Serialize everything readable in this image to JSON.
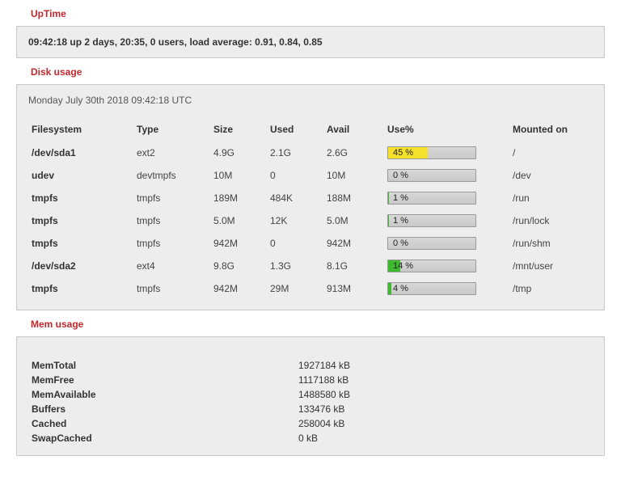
{
  "uptime": {
    "title": "UpTime",
    "text": "09:42:18 up 2 days, 20:35, 0 users, load average: 0.91, 0.84, 0.85"
  },
  "disk": {
    "title": "Disk usage",
    "date": "Monday July 30th 2018 09:42:18 UTC",
    "headers": {
      "fs": "Filesystem",
      "type": "Type",
      "size": "Size",
      "used": "Used",
      "avail": "Avail",
      "usep": "Use%",
      "mount": "Mounted on"
    },
    "rows": [
      {
        "fs": "/dev/sda1",
        "type": "ext2",
        "size": "4.9G",
        "used": "2.1G",
        "avail": "2.6G",
        "use_pct": 45,
        "use_label": "45 %",
        "color": "#f5e02c",
        "mount": "/"
      },
      {
        "fs": "udev",
        "type": "devtmpfs",
        "size": "10M",
        "used": "0",
        "avail": "10M",
        "use_pct": 0,
        "use_label": "0 %",
        "color": "#3bbb2d",
        "mount": "/dev"
      },
      {
        "fs": "tmpfs",
        "type": "tmpfs",
        "size": "189M",
        "used": "484K",
        "avail": "188M",
        "use_pct": 1,
        "use_label": "1 %",
        "color": "#3bbb2d",
        "mount": "/run"
      },
      {
        "fs": "tmpfs",
        "type": "tmpfs",
        "size": "5.0M",
        "used": "12K",
        "avail": "5.0M",
        "use_pct": 1,
        "use_label": "1 %",
        "color": "#3bbb2d",
        "mount": "/run/lock"
      },
      {
        "fs": "tmpfs",
        "type": "tmpfs",
        "size": "942M",
        "used": "0",
        "avail": "942M",
        "use_pct": 0,
        "use_label": "0 %",
        "color": "#3bbb2d",
        "mount": "/run/shm"
      },
      {
        "fs": "/dev/sda2",
        "type": "ext4",
        "size": "9.8G",
        "used": "1.3G",
        "avail": "8.1G",
        "use_pct": 14,
        "use_label": "14 %",
        "color": "#3bbb2d",
        "mount": "/mnt/user"
      },
      {
        "fs": "tmpfs",
        "type": "tmpfs",
        "size": "942M",
        "used": "29M",
        "avail": "913M",
        "use_pct": 4,
        "use_label": "4 %",
        "color": "#3bbb2d",
        "mount": "/tmp"
      }
    ]
  },
  "mem": {
    "title": "Mem usage",
    "rows": [
      {
        "key": "MemTotal",
        "val": "1927184 kB"
      },
      {
        "key": "MemFree",
        "val": "1117188 kB"
      },
      {
        "key": "MemAvailable",
        "val": "1488580 kB"
      },
      {
        "key": "Buffers",
        "val": "133476 kB"
      },
      {
        "key": "Cached",
        "val": "258004 kB"
      },
      {
        "key": "SwapCached",
        "val": "0 kB"
      }
    ]
  }
}
